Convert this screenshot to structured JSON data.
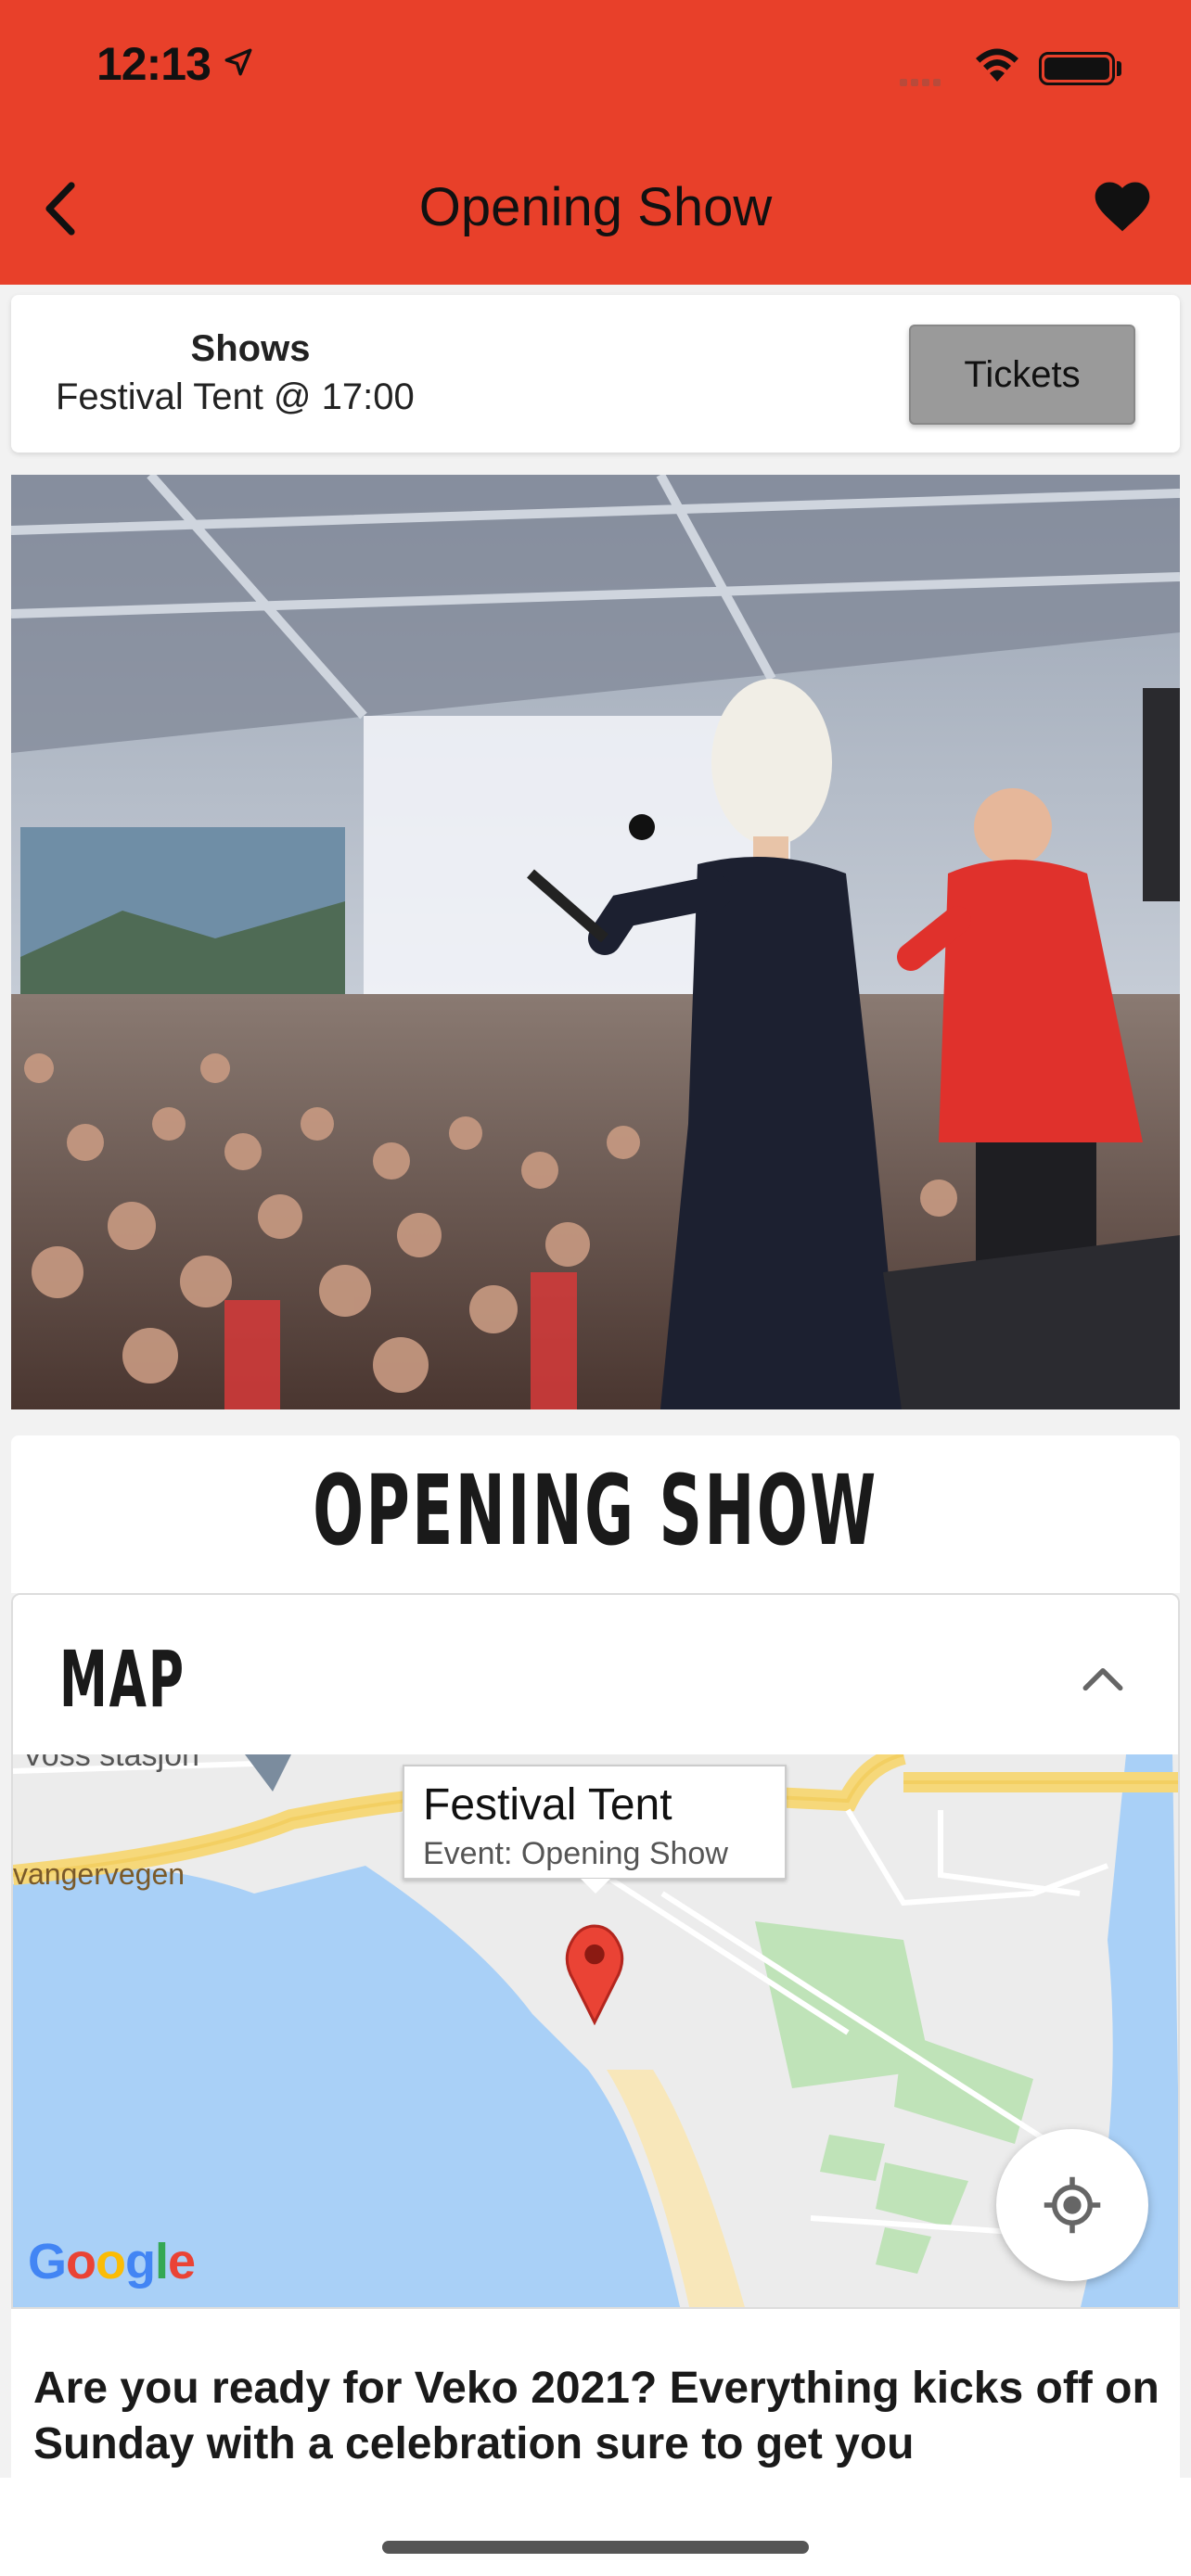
{
  "status_bar": {
    "time": "12:13"
  },
  "nav": {
    "title": "Opening Show"
  },
  "info": {
    "category": "Shows",
    "venue_time": "Festival Tent @ 17:00",
    "tickets_label": "Tickets"
  },
  "event": {
    "title": "OPENING SHOW"
  },
  "map": {
    "section_label": "MAP",
    "callout_title": "Festival Tent",
    "callout_subtitle": "Event: Opening Show",
    "street_labels": [
      "Voss stasjon",
      "vangervegen"
    ],
    "attribution": "Google"
  },
  "description": {
    "text": "Are you ready for Veko 2021? Everything kicks off on Sunday with a celebration sure to get you"
  },
  "colors": {
    "header": "#e8402a",
    "water": "#a9d0f7",
    "park": "#bfe3b8",
    "road": "#f6d87a",
    "pin": "#ea4335"
  },
  "icons": [
    "location-arrow-icon",
    "wifi-icon",
    "battery-icon",
    "back-chevron-icon",
    "heart-icon",
    "chevron-up-icon",
    "map-pin-icon",
    "my-location-icon"
  ]
}
